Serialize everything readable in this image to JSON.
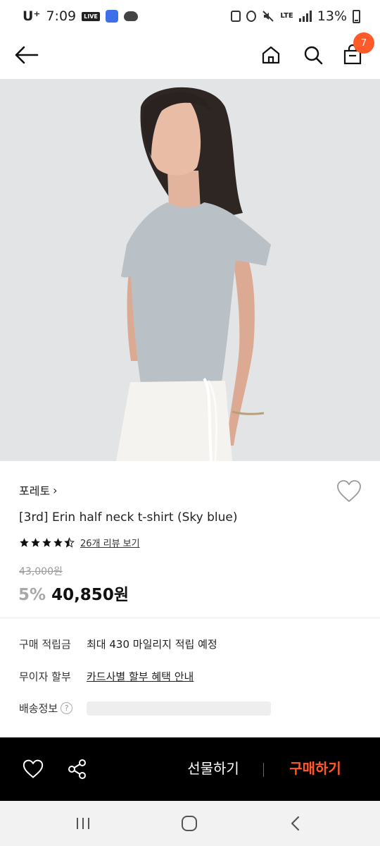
{
  "status_bar": {
    "carrier": "U⁺",
    "time": "7:09",
    "live_badge": "LIVE",
    "network": "LTE",
    "battery": "13%"
  },
  "nav": {
    "cart_count": "7"
  },
  "product": {
    "brand": "포레토",
    "brand_chevron": "›",
    "name": "[3rd] Erin half neck t-shirt (Sky blue)",
    "rating_stars": 4.5,
    "review_link": "26개 리뷰 보기",
    "original_price": "43,000원",
    "discount": "5%",
    "sale_price": "40,850원"
  },
  "info_rows": [
    {
      "label": "구매 적립금",
      "value": "최대 430 마일리지 적립 예정"
    },
    {
      "label": "무이자 할부",
      "value": "카드사별 할부 혜택 안내"
    },
    {
      "label": "배송정보",
      "help": "?"
    }
  ],
  "action_bar": {
    "gift_label": "선물하기",
    "buy_label": "구매하기"
  },
  "colors": {
    "accent": "#ff5a2a",
    "action_bar_bg": "#000000",
    "discount_gray": "#a8a8a8",
    "shirt": "#b9c0c6"
  },
  "icons": [
    "back-arrow-icon",
    "home-icon",
    "search-icon",
    "shopping-bag-icon",
    "heart-icon",
    "share-icon",
    "recent-apps-icon",
    "home-circle-icon",
    "back-chevron-icon"
  ]
}
